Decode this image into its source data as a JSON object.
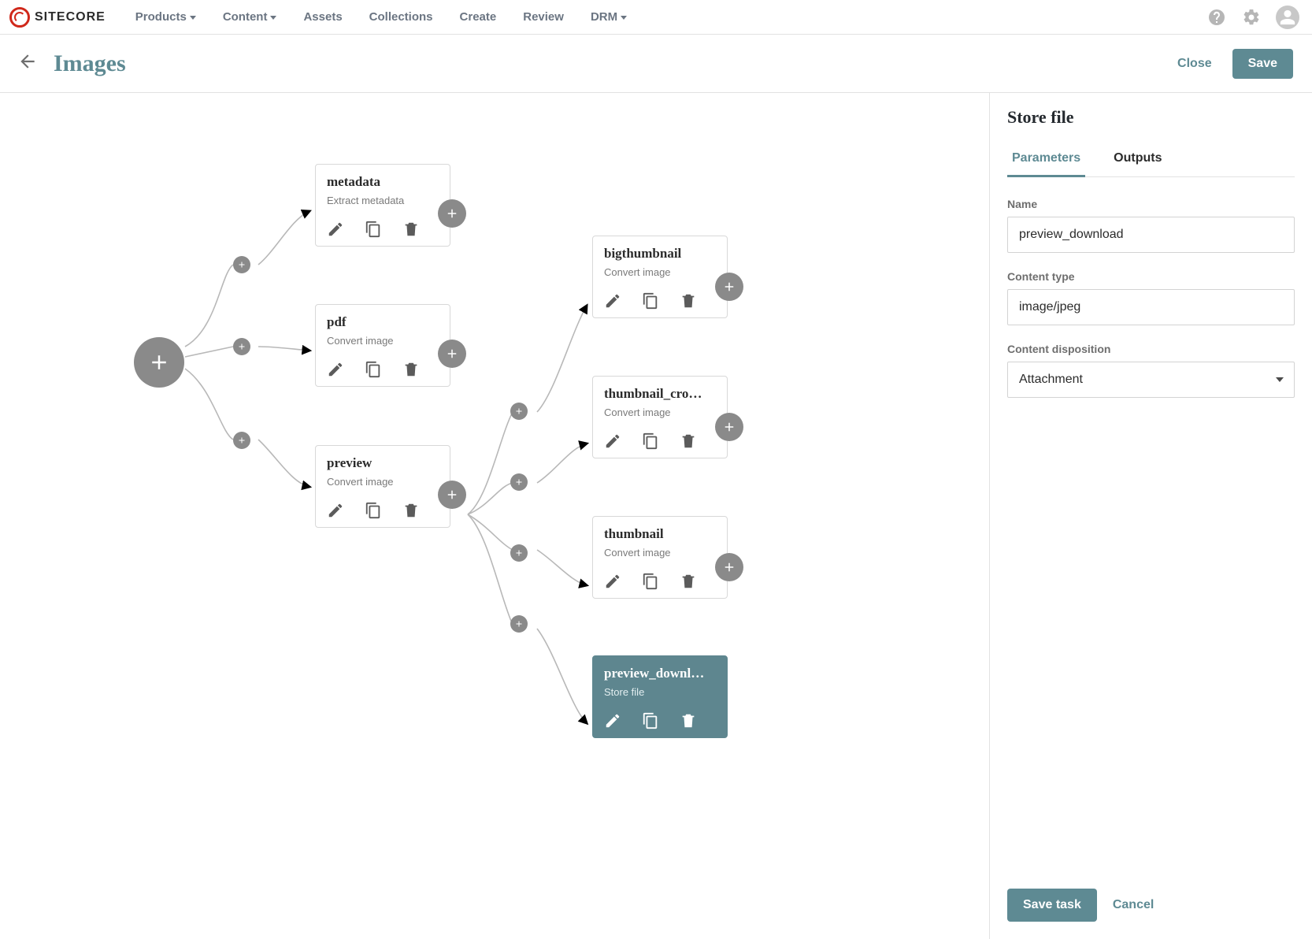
{
  "brand": "SITECORE",
  "nav": {
    "items": [
      {
        "label": "Products",
        "dropdown": true
      },
      {
        "label": "Content",
        "dropdown": true
      },
      {
        "label": "Assets",
        "dropdown": false
      },
      {
        "label": "Collections",
        "dropdown": false
      },
      {
        "label": "Create",
        "dropdown": false
      },
      {
        "label": "Review",
        "dropdown": false
      },
      {
        "label": "DRM",
        "dropdown": true
      }
    ]
  },
  "titlebar": {
    "title": "Images",
    "close": "Close",
    "save": "Save"
  },
  "nodes": {
    "metadata": {
      "title": "metadata",
      "subtitle": "Extract metadata"
    },
    "pdf": {
      "title": "pdf",
      "subtitle": "Convert image"
    },
    "preview": {
      "title": "preview",
      "subtitle": "Convert image"
    },
    "bigthumbnail": {
      "title": "bigthumbnail",
      "subtitle": "Convert image"
    },
    "thumbnail_cro": {
      "title": "thumbnail_cro…",
      "subtitle": "Convert image"
    },
    "thumbnail": {
      "title": "thumbnail",
      "subtitle": "Convert image"
    },
    "preview_downl": {
      "title": "preview_downl…",
      "subtitle": "Store file"
    }
  },
  "side": {
    "heading": "Store file",
    "tabs": {
      "parameters": "Parameters",
      "outputs": "Outputs"
    },
    "form": {
      "name_label": "Name",
      "name_value": "preview_download",
      "content_type_label": "Content type",
      "content_type_value": "image/jpeg",
      "content_disposition_label": "Content disposition",
      "content_disposition_value": "Attachment"
    },
    "footer": {
      "save_task": "Save task",
      "cancel": "Cancel"
    }
  }
}
